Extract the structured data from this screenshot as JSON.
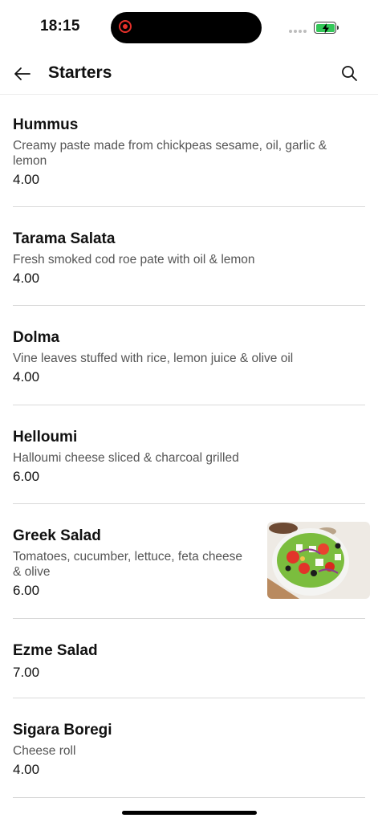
{
  "status_bar": {
    "time": "18:15"
  },
  "header": {
    "title": "Starters",
    "back_icon": "arrow-left-icon",
    "search_icon": "search-icon"
  },
  "items": [
    {
      "name": "Hummus",
      "description": "Creamy paste made from chickpeas sesame, oil, garlic & lemon",
      "price": "4.00"
    },
    {
      "name": "Tarama Salata",
      "description": "Fresh smoked cod roe pate with oil & lemon",
      "price": "4.00"
    },
    {
      "name": "Dolma",
      "description": "Vine leaves stuffed with rice, lemon juice & olive oil",
      "price": "4.00"
    },
    {
      "name": "Helloumi",
      "description": "Halloumi cheese sliced & charcoal grilled",
      "price": "6.00"
    },
    {
      "name": "Greek Salad",
      "description": "Tomatoes, cucumber, lettuce, feta cheese & olive",
      "price": "6.00"
    },
    {
      "name": "Ezme Salad",
      "description": "",
      "price": "7.00"
    },
    {
      "name": "Sigara Boregi",
      "description": "Cheese roll",
      "price": "4.00"
    }
  ],
  "colors": {
    "accent_battery": "#34c759",
    "recording": "#e5302a"
  }
}
